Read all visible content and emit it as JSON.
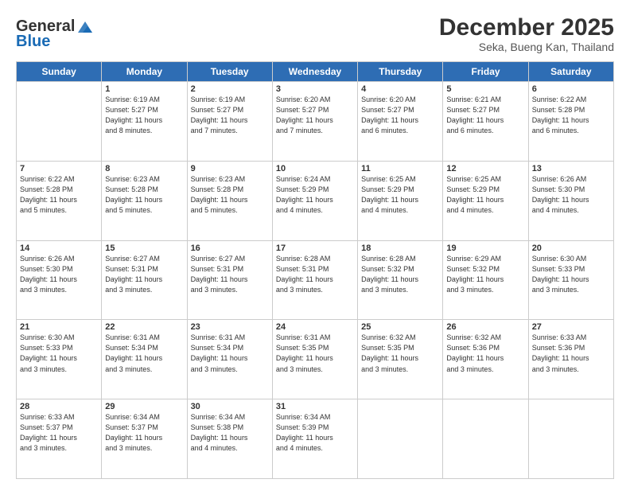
{
  "header": {
    "logo_line1": "General",
    "logo_line2": "Blue",
    "month": "December 2025",
    "location": "Seka, Bueng Kan, Thailand"
  },
  "days_of_week": [
    "Sunday",
    "Monday",
    "Tuesday",
    "Wednesday",
    "Thursday",
    "Friday",
    "Saturday"
  ],
  "weeks": [
    [
      {
        "day": "",
        "info": ""
      },
      {
        "day": "1",
        "info": "Sunrise: 6:19 AM\nSunset: 5:27 PM\nDaylight: 11 hours\nand 8 minutes."
      },
      {
        "day": "2",
        "info": "Sunrise: 6:19 AM\nSunset: 5:27 PM\nDaylight: 11 hours\nand 7 minutes."
      },
      {
        "day": "3",
        "info": "Sunrise: 6:20 AM\nSunset: 5:27 PM\nDaylight: 11 hours\nand 7 minutes."
      },
      {
        "day": "4",
        "info": "Sunrise: 6:20 AM\nSunset: 5:27 PM\nDaylight: 11 hours\nand 6 minutes."
      },
      {
        "day": "5",
        "info": "Sunrise: 6:21 AM\nSunset: 5:27 PM\nDaylight: 11 hours\nand 6 minutes."
      },
      {
        "day": "6",
        "info": "Sunrise: 6:22 AM\nSunset: 5:28 PM\nDaylight: 11 hours\nand 6 minutes."
      }
    ],
    [
      {
        "day": "7",
        "info": "Sunrise: 6:22 AM\nSunset: 5:28 PM\nDaylight: 11 hours\nand 5 minutes."
      },
      {
        "day": "8",
        "info": "Sunrise: 6:23 AM\nSunset: 5:28 PM\nDaylight: 11 hours\nand 5 minutes."
      },
      {
        "day": "9",
        "info": "Sunrise: 6:23 AM\nSunset: 5:28 PM\nDaylight: 11 hours\nand 5 minutes."
      },
      {
        "day": "10",
        "info": "Sunrise: 6:24 AM\nSunset: 5:29 PM\nDaylight: 11 hours\nand 4 minutes."
      },
      {
        "day": "11",
        "info": "Sunrise: 6:25 AM\nSunset: 5:29 PM\nDaylight: 11 hours\nand 4 minutes."
      },
      {
        "day": "12",
        "info": "Sunrise: 6:25 AM\nSunset: 5:29 PM\nDaylight: 11 hours\nand 4 minutes."
      },
      {
        "day": "13",
        "info": "Sunrise: 6:26 AM\nSunset: 5:30 PM\nDaylight: 11 hours\nand 4 minutes."
      }
    ],
    [
      {
        "day": "14",
        "info": "Sunrise: 6:26 AM\nSunset: 5:30 PM\nDaylight: 11 hours\nand 3 minutes."
      },
      {
        "day": "15",
        "info": "Sunrise: 6:27 AM\nSunset: 5:31 PM\nDaylight: 11 hours\nand 3 minutes."
      },
      {
        "day": "16",
        "info": "Sunrise: 6:27 AM\nSunset: 5:31 PM\nDaylight: 11 hours\nand 3 minutes."
      },
      {
        "day": "17",
        "info": "Sunrise: 6:28 AM\nSunset: 5:31 PM\nDaylight: 11 hours\nand 3 minutes."
      },
      {
        "day": "18",
        "info": "Sunrise: 6:28 AM\nSunset: 5:32 PM\nDaylight: 11 hours\nand 3 minutes."
      },
      {
        "day": "19",
        "info": "Sunrise: 6:29 AM\nSunset: 5:32 PM\nDaylight: 11 hours\nand 3 minutes."
      },
      {
        "day": "20",
        "info": "Sunrise: 6:30 AM\nSunset: 5:33 PM\nDaylight: 11 hours\nand 3 minutes."
      }
    ],
    [
      {
        "day": "21",
        "info": "Sunrise: 6:30 AM\nSunset: 5:33 PM\nDaylight: 11 hours\nand 3 minutes."
      },
      {
        "day": "22",
        "info": "Sunrise: 6:31 AM\nSunset: 5:34 PM\nDaylight: 11 hours\nand 3 minutes."
      },
      {
        "day": "23",
        "info": "Sunrise: 6:31 AM\nSunset: 5:34 PM\nDaylight: 11 hours\nand 3 minutes."
      },
      {
        "day": "24",
        "info": "Sunrise: 6:31 AM\nSunset: 5:35 PM\nDaylight: 11 hours\nand 3 minutes."
      },
      {
        "day": "25",
        "info": "Sunrise: 6:32 AM\nSunset: 5:35 PM\nDaylight: 11 hours\nand 3 minutes."
      },
      {
        "day": "26",
        "info": "Sunrise: 6:32 AM\nSunset: 5:36 PM\nDaylight: 11 hours\nand 3 minutes."
      },
      {
        "day": "27",
        "info": "Sunrise: 6:33 AM\nSunset: 5:36 PM\nDaylight: 11 hours\nand 3 minutes."
      }
    ],
    [
      {
        "day": "28",
        "info": "Sunrise: 6:33 AM\nSunset: 5:37 PM\nDaylight: 11 hours\nand 3 minutes."
      },
      {
        "day": "29",
        "info": "Sunrise: 6:34 AM\nSunset: 5:37 PM\nDaylight: 11 hours\nand 3 minutes."
      },
      {
        "day": "30",
        "info": "Sunrise: 6:34 AM\nSunset: 5:38 PM\nDaylight: 11 hours\nand 4 minutes."
      },
      {
        "day": "31",
        "info": "Sunrise: 6:34 AM\nSunset: 5:39 PM\nDaylight: 11 hours\nand 4 minutes."
      },
      {
        "day": "",
        "info": ""
      },
      {
        "day": "",
        "info": ""
      },
      {
        "day": "",
        "info": ""
      }
    ]
  ]
}
